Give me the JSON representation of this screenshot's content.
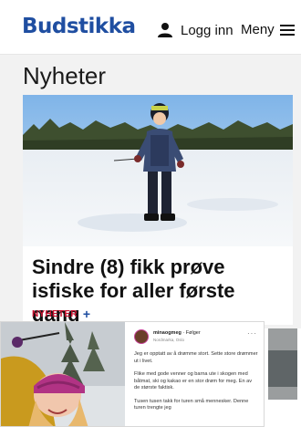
{
  "header": {
    "logo": "Budstikka",
    "login_label": "Logg inn",
    "menu_label": "Meny"
  },
  "section": {
    "title": "Nyheter"
  },
  "article": {
    "headline": "Sindre (8) fikk prøve isfiske for aller første gang",
    "tag": "NYHETER",
    "tag_plus": "+"
  },
  "ad": {
    "account_name": "minaogmeg",
    "follow": "· Følger",
    "location": "Nordmarka, Oslo",
    "more": "···",
    "caption": [
      "Jeg er opptatt av å drømme stort. Sette store drømmer ut i livet.",
      "Flike med gode venner og barna ute i skogen med båtmat, ski og kakao er en stor drøm for meg. En av de største faktisk.",
      "Tusen tusen takk for turen små mennesker. Denne turen trengte jeg"
    ]
  },
  "colors": {
    "brand": "#1f4ea1",
    "tag": "#c8102e"
  }
}
